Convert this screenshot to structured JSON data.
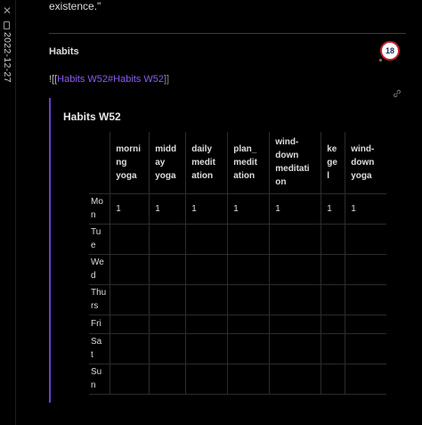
{
  "sidebar": {
    "close_glyph": "✕",
    "date": "2022-12-27",
    "icons": [
      "close-icon",
      "file-icon"
    ]
  },
  "note": {
    "top_text": "existence.\"",
    "heading": "Habits",
    "badge_count": "18",
    "embed_open": "![[",
    "embed_link_text": "Habits W52#Habits W52",
    "embed_close": "]]",
    "embed_title": "Habits W52"
  },
  "table": {
    "columns": [
      "",
      "morni ng yoga",
      "midd ay yoga",
      "daily medit ation",
      "plan_ medit ation",
      "wind- down meditati on",
      "ke ge l",
      "wind- down yoga"
    ],
    "column_lines": [
      [],
      [
        "morni",
        "ng",
        "yoga"
      ],
      [
        "midd",
        "ay",
        "yoga"
      ],
      [
        "daily",
        "medit",
        "ation"
      ],
      [
        "plan_",
        "medit",
        "ation"
      ],
      [
        "wind-",
        "down",
        "meditati",
        "on"
      ],
      [
        "ke",
        "ge",
        "l"
      ],
      [
        "wind-",
        "down",
        "yoga"
      ]
    ],
    "rows": [
      {
        "day_lines": [
          "Mo",
          "n"
        ],
        "values": [
          "1",
          "1",
          "1",
          "1",
          "1",
          "1",
          "1"
        ]
      },
      {
        "day_lines": [
          "Tu",
          "e"
        ],
        "values": [
          "",
          "",
          "",
          "",
          "",
          "",
          ""
        ]
      },
      {
        "day_lines": [
          "We",
          "d"
        ],
        "values": [
          "",
          "",
          "",
          "",
          "",
          "",
          ""
        ]
      },
      {
        "day_lines": [
          "Thu",
          "rs"
        ],
        "values": [
          "",
          "",
          "",
          "",
          "",
          "",
          ""
        ]
      },
      {
        "day_lines": [
          "Fri"
        ],
        "values": [
          "",
          "",
          "",
          "",
          "",
          "",
          ""
        ]
      },
      {
        "day_lines": [
          "Sa",
          "t"
        ],
        "values": [
          "",
          "",
          "",
          "",
          "",
          "",
          ""
        ]
      },
      {
        "day_lines": [
          "Su",
          "n"
        ],
        "values": [
          "",
          "",
          "",
          "",
          "",
          "",
          ""
        ]
      }
    ]
  },
  "colors": {
    "background": "#000000",
    "accent": "#6b3fd1",
    "link": "#8a5cf5",
    "text": "#dcddde"
  }
}
